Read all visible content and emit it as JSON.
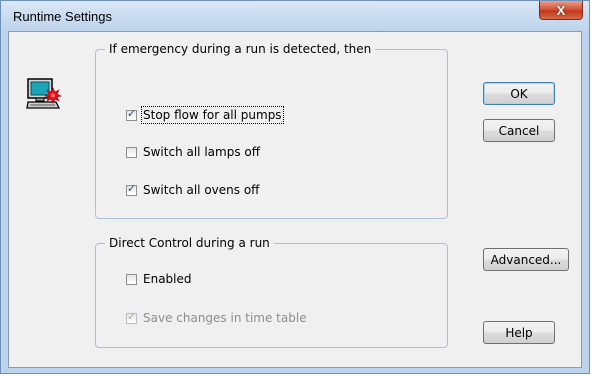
{
  "window": {
    "title": "Runtime Settings",
    "close_label": "X"
  },
  "emergency_group": {
    "legend": "If emergency during a run is detected, then",
    "items": [
      {
        "label": "Stop flow for all pumps",
        "checked": true
      },
      {
        "label": "Switch all lamps off",
        "checked": false
      },
      {
        "label": "Switch all ovens off",
        "checked": true
      }
    ]
  },
  "direct_control_group": {
    "legend": "Direct Control during a run",
    "items": [
      {
        "label": "Enabled",
        "checked": false
      },
      {
        "label": "Save changes in time table",
        "checked": true,
        "disabled": true
      }
    ]
  },
  "buttons": {
    "ok": "OK",
    "cancel": "Cancel",
    "advanced": "Advanced...",
    "help": "Help"
  },
  "icons": {
    "dialog_icon": "computer-alert-icon"
  }
}
